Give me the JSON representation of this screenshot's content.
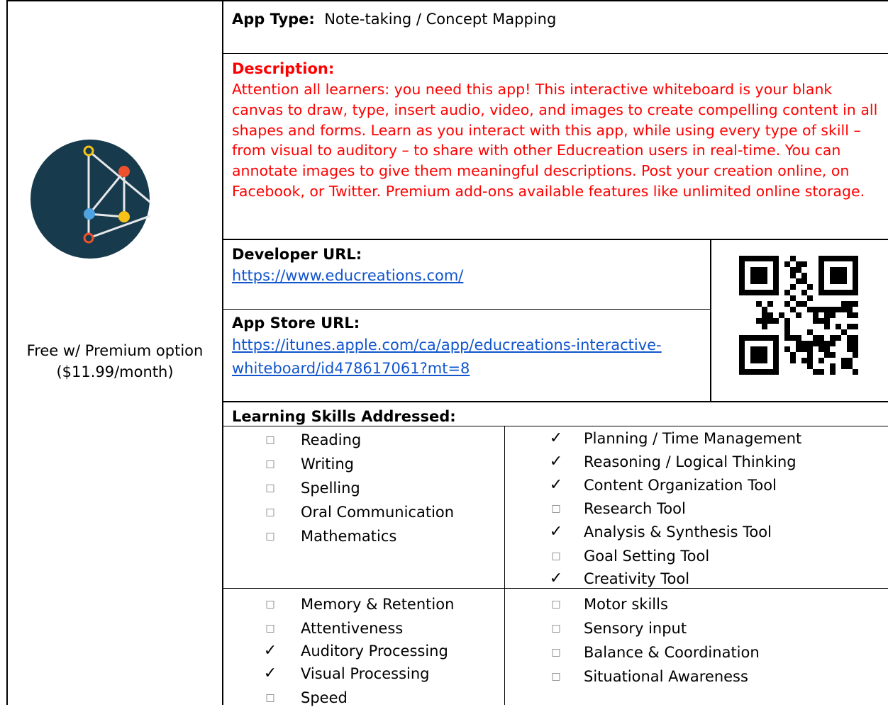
{
  "app": {
    "price_line1": "Free w/ Premium option",
    "price_line2": "($11.99/month)"
  },
  "app_type": {
    "label": "App Type:",
    "value": "Note-taking / Concept Mapping"
  },
  "description": {
    "label": "Description:",
    "text": "Attention all learners: you need this app! This interactive whiteboard is your blank canvas to draw, type, insert audio, video, and images to create compelling content in all shapes and forms. Learn as you interact with this app, while using every type of skill – from visual to auditory – to share with other Educreation users in real-time. You can annotate images to give them meaningful descriptions. Post your creation online, on Facebook, or Twitter. Premium add-ons available features like unlimited online storage."
  },
  "developer": {
    "label": "Developer URL:",
    "url": "https://www.educreations.com/"
  },
  "app_store": {
    "label": "App Store URL:",
    "url_line1": "https://itunes.apple.com/ca/app/educreations-interactive-",
    "url_line2": "whiteboard/id478617061?mt=8"
  },
  "skills": {
    "label": "Learning Skills Addressed:",
    "group1_left": [
      {
        "name": "Reading",
        "checked": false
      },
      {
        "name": "Writing",
        "checked": false
      },
      {
        "name": "Spelling",
        "checked": false
      },
      {
        "name": "Oral Communication",
        "checked": false
      },
      {
        "name": "Mathematics",
        "checked": false
      }
    ],
    "group1_right": [
      {
        "name": "Planning / Time Management",
        "checked": true
      },
      {
        "name": "Reasoning / Logical Thinking",
        "checked": true
      },
      {
        "name": "Content Organization Tool",
        "checked": true
      },
      {
        "name": "Research Tool",
        "checked": false
      },
      {
        "name": "Analysis & Synthesis Tool",
        "checked": true
      },
      {
        "name": "Goal Setting Tool",
        "checked": false
      },
      {
        "name": "Creativity Tool",
        "checked": true
      }
    ],
    "group2_left": [
      {
        "name": "Memory & Retention",
        "checked": false
      },
      {
        "name": "Attentiveness",
        "checked": false
      },
      {
        "name": "Auditory Processing",
        "checked": true
      },
      {
        "name": "Visual Processing",
        "checked": true
      },
      {
        "name": "Speed",
        "checked": false
      }
    ],
    "group2_right": [
      {
        "name": "Motor skills",
        "checked": false
      },
      {
        "name": "Sensory input",
        "checked": false
      },
      {
        "name": "Balance & Coordination",
        "checked": false
      },
      {
        "name": "Situational Awareness",
        "checked": false
      }
    ]
  },
  "glyphs": {
    "check": "✓",
    "box": "□"
  },
  "colors": {
    "description": "#ff0000",
    "link": "#1155cc",
    "logo_bg": "#173a4d"
  }
}
